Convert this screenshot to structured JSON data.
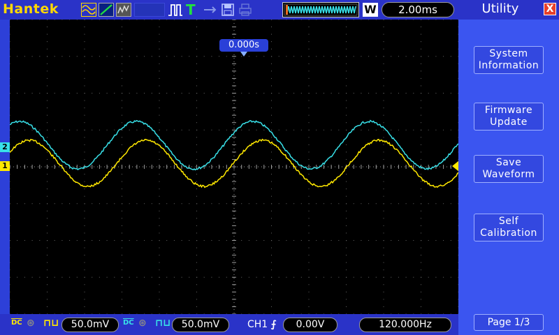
{
  "brand": "Hantek",
  "toolbar": {
    "trigger_letter": "T",
    "w_label": "W",
    "timebase": "2.00ms"
  },
  "screen": {
    "trigger_position": "0.000s",
    "ch1_marker": "1",
    "ch2_marker": "2"
  },
  "panel": {
    "title": "Utility",
    "close_label": "X",
    "buttons": [
      {
        "line1": "System",
        "line2": "Information"
      },
      {
        "line1": "Firmware",
        "line2": "Update"
      },
      {
        "line1": "Save",
        "line2": "Waveform"
      },
      {
        "line1": "Self",
        "line2": "Calibration"
      }
    ],
    "page": "Page 1/3"
  },
  "bottom": {
    "ch1_coupling": "DC",
    "ch1_volts": "50.0mV",
    "ch2_coupling": "DC",
    "ch2_volts": "50.0mV",
    "trigger_source": "CH1",
    "trigger_level": "0.00V",
    "frequency": "120.000Hz"
  },
  "colors": {
    "ch1": "#ffe800",
    "ch2": "#38e0e8",
    "background": "#000000",
    "bar": "#2a33c8"
  }
}
